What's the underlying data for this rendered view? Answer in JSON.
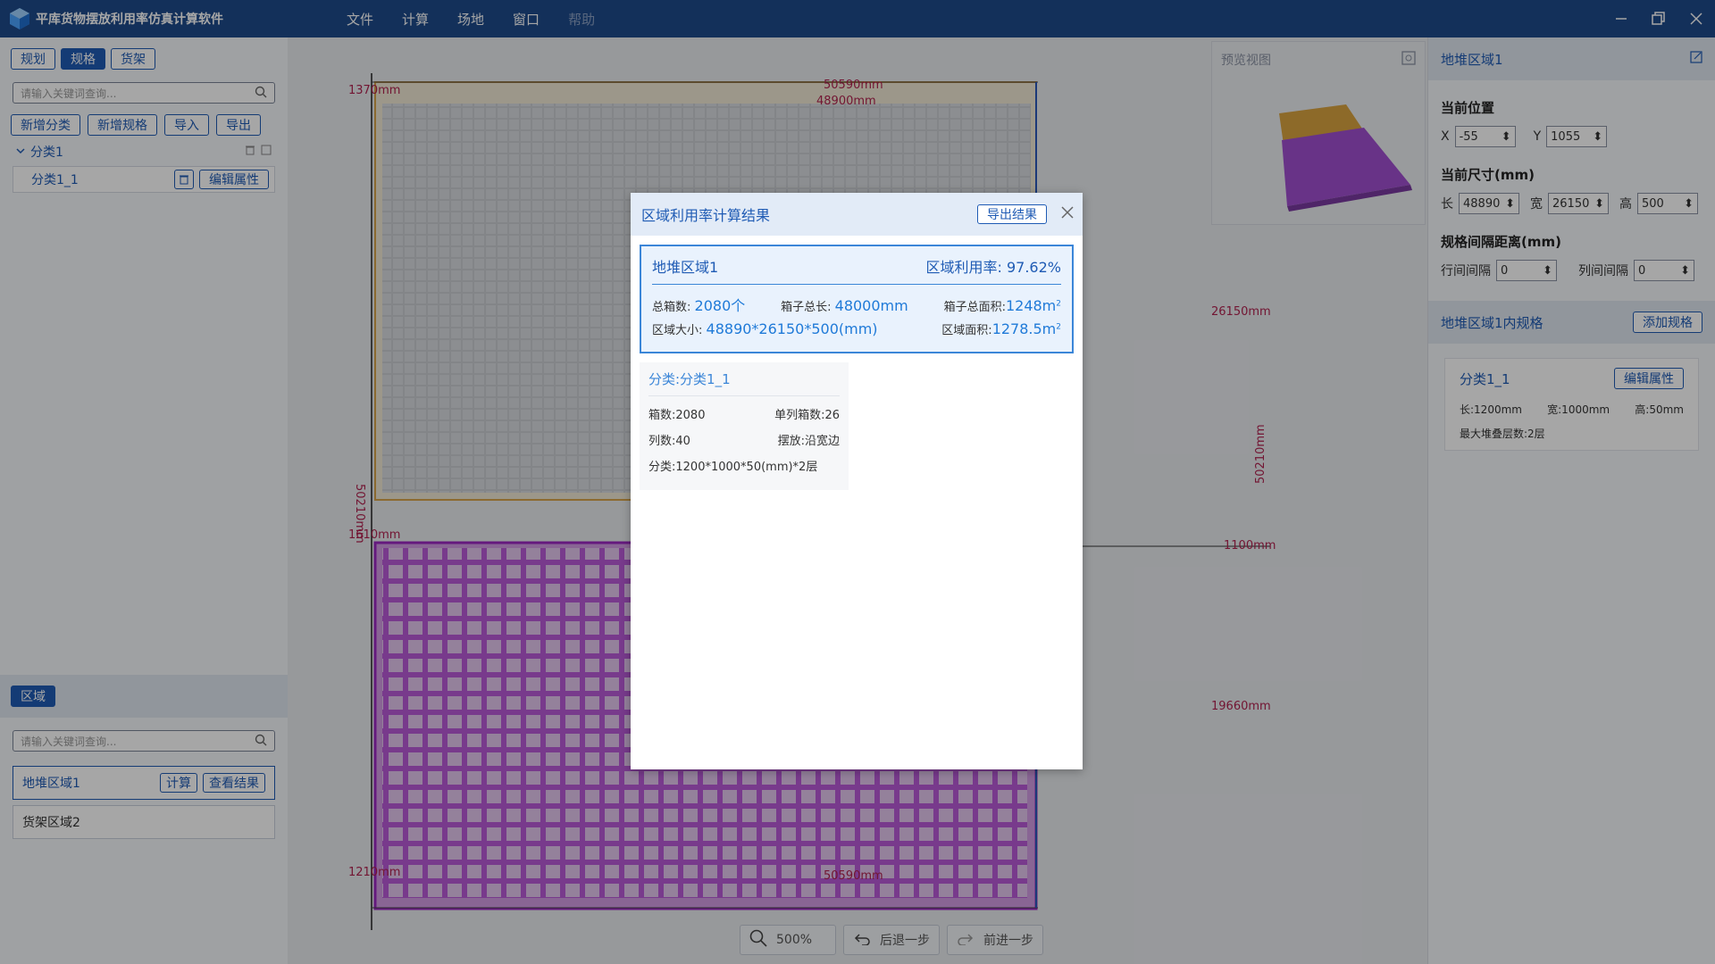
{
  "app": {
    "title": "平库货物摆放利用率仿真计算软件"
  },
  "menu": [
    {
      "label": "文件",
      "enabled": true
    },
    {
      "label": "计算",
      "enabled": true
    },
    {
      "label": "场地",
      "enabled": true
    },
    {
      "label": "窗口",
      "enabled": true
    },
    {
      "label": "帮助",
      "enabled": false
    }
  ],
  "left": {
    "tabs": [
      "规划",
      "规格",
      "货架"
    ],
    "active_tab": "规格",
    "search_placeholder": "请输入关键词查询...",
    "actions": [
      "新增分类",
      "新增规格",
      "导入",
      "导出"
    ],
    "tree": {
      "node_label": "分类1",
      "leaf_label": "分类1_1",
      "edit_label": "编辑属性"
    },
    "region_tab": "区域",
    "region_search_placeholder": "请输入关键词查询...",
    "regions": [
      {
        "label": "地堆区域1",
        "calc": "计算",
        "view": "查看结果"
      },
      {
        "label": "货架区域2"
      }
    ]
  },
  "canvas": {
    "dims": {
      "top_outer": "50590mm",
      "top_inner": "48900mm",
      "left_top": "1370mm",
      "left_mid": "1610mm",
      "left_bottom": "1210mm",
      "left_vertical": "50210mm",
      "right_26150": "26150mm",
      "right_1100": "1100mm",
      "right_19660": "19660mm",
      "right_vertical": "50210mm",
      "bottom_outer": "50590mm"
    },
    "toolbar": {
      "zoom": "500%",
      "undo": "后退一步",
      "redo": "前进一步"
    }
  },
  "preview": {
    "title": "预览视图"
  },
  "right": {
    "header": "地堆区域1",
    "position_label": "当前位置",
    "x_label": "X",
    "x_value": "-55",
    "y_label": "Y",
    "y_value": "1055",
    "size_label": "当前尺寸(mm)",
    "len_label": "长",
    "len_value": "48890",
    "wid_label": "宽",
    "wid_value": "26150",
    "hgt_label": "高",
    "hgt_value": "500",
    "gap_label": "规格间隔距离(mm)",
    "row_gap_label": "行间间隔",
    "row_gap_value": "0",
    "col_gap_label": "列间间隔",
    "col_gap_value": "0",
    "spec_header": "地堆区域1内规格",
    "add_spec": "添加规格",
    "spec": {
      "name": "分类1_1",
      "edit": "编辑属性",
      "length": "长:1200mm",
      "width": "宽:1000mm",
      "height": "高:50mm",
      "max_layers": "最大堆叠层数:2层"
    }
  },
  "dialog": {
    "title": "区域利用率计算结果",
    "export": "导出结果",
    "area_name": "地堆区域1",
    "util_label": "区域利用率:",
    "util_value": "97.62%",
    "total_box_label": "总箱数:",
    "total_box_value": "2080个",
    "box_len_label": "箱子总长:",
    "box_len_value": "48000mm",
    "box_area_label": "箱子总面积:",
    "box_area_value": "1248m",
    "area_size_label": "区域大小:",
    "area_size_value": "48890*26150*500(mm)",
    "area_area_label": "区域面积:",
    "area_area_value": "1278.5m",
    "sup": "2",
    "category": {
      "title": "分类:分类1_1",
      "boxes": "箱数:2080",
      "per_column": "单列箱数:26",
      "columns": "列数:40",
      "placement": "摆放:沿宽边",
      "spec": "分类:1200*1000*50(mm)*2层"
    }
  }
}
